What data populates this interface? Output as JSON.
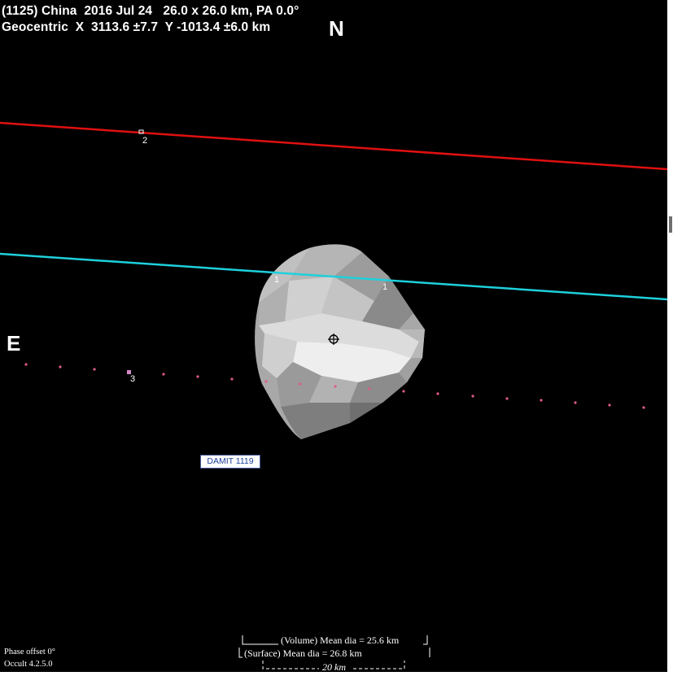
{
  "header": {
    "line1": "(1125) China  2016 Jul 24   26.0 x 26.0 km, PA 0.0°",
    "line2": "Geocentric  X  3113.6 ±7.7  Y -1013.4 ±6.0 km"
  },
  "compass": {
    "north": "N",
    "east": "E"
  },
  "chords": [
    {
      "label": "2",
      "color": "#e01010"
    },
    {
      "label": "1",
      "color": "#1ed0dc"
    },
    {
      "label": "1",
      "color": "#1ed0dc"
    },
    {
      "label": "3",
      "color": "#e05a8a"
    }
  ],
  "model_label": "DAMIT 1119",
  "diameters": {
    "volume": "(Volume) Mean dia = 25.6 km",
    "surface": "(Surface) Mean dia = 26.8 km",
    "scale": "20 km"
  },
  "footer": {
    "phase_offset": "Phase offset 0°",
    "version": "Occult 4.2.5.0"
  },
  "colors": {
    "background": "#000000",
    "chord_red": "#e01010",
    "chord_cyan": "#1ed0dc",
    "chord_miss": "#e05a8a",
    "text": "#ffffff"
  }
}
